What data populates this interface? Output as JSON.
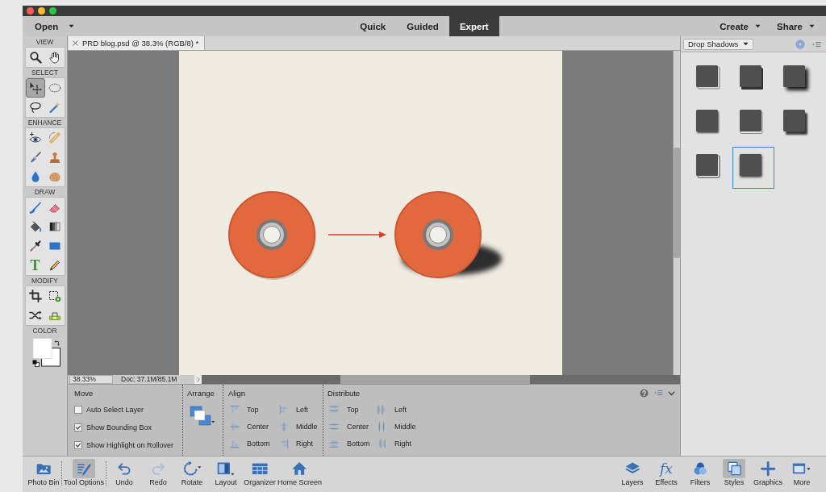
{
  "window": {
    "open_menu": {
      "label": "Open"
    },
    "mode_tabs": [
      {
        "label": "Quick",
        "selected": false
      },
      {
        "label": "Guided",
        "selected": false
      },
      {
        "label": "Expert",
        "selected": true
      }
    ],
    "right_menus": [
      {
        "label": "Create"
      },
      {
        "label": "Share"
      }
    ]
  },
  "toolbox": {
    "sections": [
      {
        "label": "VIEW",
        "tools": [
          {
            "selected": false
          },
          {
            "selected": false
          }
        ]
      },
      {
        "label": "SELECT",
        "tools": [
          {
            "selected": true
          },
          {
            "selected": false
          },
          {
            "selected": false
          },
          {
            "selected": false
          }
        ]
      },
      {
        "label": "ENHANCE",
        "tools": [
          {
            "selected": false
          },
          {
            "selected": false
          },
          {
            "selected": false
          },
          {
            "selected": false
          },
          {
            "selected": false
          },
          {
            "selected": false
          }
        ]
      },
      {
        "label": "DRAW",
        "tools": [
          {
            "selected": false
          },
          {
            "selected": false
          },
          {
            "selected": false
          },
          {
            "selected": false
          },
          {
            "selected": false
          },
          {
            "selected": false
          },
          {
            "selected": false,
            "glyph": "T"
          },
          {
            "selected": false
          }
        ]
      },
      {
        "label": "MODIFY",
        "tools": [
          {
            "selected": false
          },
          {
            "selected": false
          },
          {
            "selected": false
          },
          {
            "selected": false
          }
        ]
      }
    ],
    "color_label": "COLOR"
  },
  "document": {
    "tab_title": "PRD blog.psd @ 38.3% (RGB/8) *",
    "zoom": "38.33%",
    "doc_info": "Doc: 37.1M/85.1M"
  },
  "tool_options": {
    "title": "Move",
    "checkboxes": [
      {
        "label": "Auto Select Layer",
        "checked": false
      },
      {
        "label": "Show Bounding Box",
        "checked": true
      },
      {
        "label": "Show Highlight on Rollover",
        "checked": true
      }
    ],
    "arrange": {
      "label": "Arrange"
    },
    "align": {
      "label": "Align",
      "buttons": [
        "Top",
        "Center",
        "Bottom",
        "Left",
        "Middle",
        "Right"
      ]
    },
    "distribute": {
      "label": "Distribute",
      "buttons": [
        "Top",
        "Center",
        "Bottom",
        "Left",
        "Middle",
        "Right"
      ]
    }
  },
  "panel": {
    "dropdown": "Drop Shadows",
    "styles": [
      {
        "selected": false
      },
      {
        "selected": false
      },
      {
        "selected": false
      },
      {
        "selected": false
      },
      {
        "selected": false
      },
      {
        "selected": false
      },
      {
        "selected": false
      },
      {
        "selected": true
      }
    ]
  },
  "taskbar": {
    "left": [
      {
        "label": "Photo Bin",
        "selected": false,
        "disabled": false
      },
      {
        "label": "Tool Options",
        "selected": true,
        "disabled": false
      },
      {
        "label": "Undo",
        "selected": false,
        "disabled": false
      },
      {
        "label": "Redo",
        "selected": false,
        "disabled": true
      },
      {
        "label": "Rotate",
        "selected": false,
        "disabled": false
      },
      {
        "label": "Layout",
        "selected": false,
        "disabled": false
      },
      {
        "label": "Organizer",
        "selected": false,
        "disabled": false
      },
      {
        "label": "Home Screen",
        "selected": false,
        "disabled": false
      }
    ],
    "right": [
      {
        "label": "Layers",
        "selected": false
      },
      {
        "label": "Effects",
        "selected": false,
        "glyph": "fx"
      },
      {
        "label": "Filters",
        "selected": false
      },
      {
        "label": "Styles",
        "selected": true
      },
      {
        "label": "Graphics",
        "selected": false
      },
      {
        "label": "More",
        "selected": false
      }
    ]
  }
}
